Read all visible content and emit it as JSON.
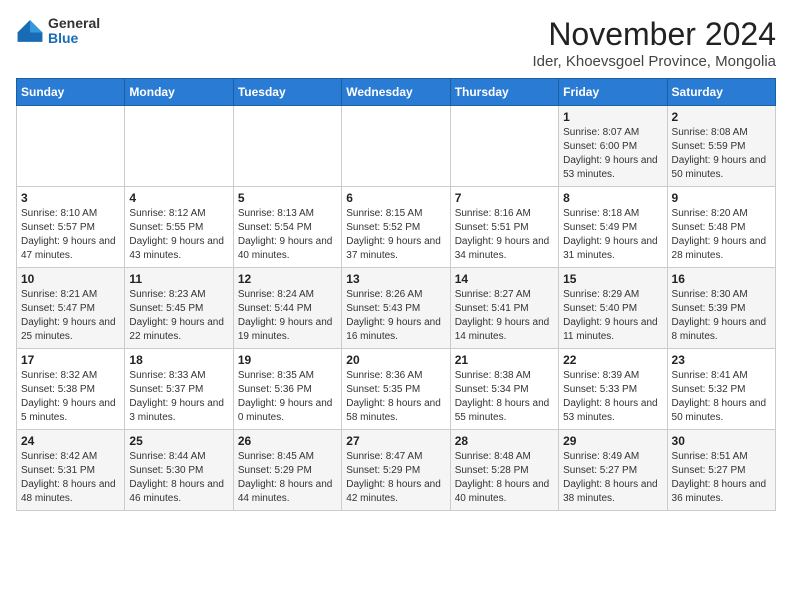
{
  "logo": {
    "general": "General",
    "blue": "Blue"
  },
  "title": "November 2024",
  "subtitle": "Ider, Khoevsgoel Province, Mongolia",
  "days_of_week": [
    "Sunday",
    "Monday",
    "Tuesday",
    "Wednesday",
    "Thursday",
    "Friday",
    "Saturday"
  ],
  "weeks": [
    [
      {
        "day": "",
        "details": ""
      },
      {
        "day": "",
        "details": ""
      },
      {
        "day": "",
        "details": ""
      },
      {
        "day": "",
        "details": ""
      },
      {
        "day": "",
        "details": ""
      },
      {
        "day": "1",
        "details": "Sunrise: 8:07 AM\nSunset: 6:00 PM\nDaylight: 9 hours and 53 minutes."
      },
      {
        "day": "2",
        "details": "Sunrise: 8:08 AM\nSunset: 5:59 PM\nDaylight: 9 hours and 50 minutes."
      }
    ],
    [
      {
        "day": "3",
        "details": "Sunrise: 8:10 AM\nSunset: 5:57 PM\nDaylight: 9 hours and 47 minutes."
      },
      {
        "day": "4",
        "details": "Sunrise: 8:12 AM\nSunset: 5:55 PM\nDaylight: 9 hours and 43 minutes."
      },
      {
        "day": "5",
        "details": "Sunrise: 8:13 AM\nSunset: 5:54 PM\nDaylight: 9 hours and 40 minutes."
      },
      {
        "day": "6",
        "details": "Sunrise: 8:15 AM\nSunset: 5:52 PM\nDaylight: 9 hours and 37 minutes."
      },
      {
        "day": "7",
        "details": "Sunrise: 8:16 AM\nSunset: 5:51 PM\nDaylight: 9 hours and 34 minutes."
      },
      {
        "day": "8",
        "details": "Sunrise: 8:18 AM\nSunset: 5:49 PM\nDaylight: 9 hours and 31 minutes."
      },
      {
        "day": "9",
        "details": "Sunrise: 8:20 AM\nSunset: 5:48 PM\nDaylight: 9 hours and 28 minutes."
      }
    ],
    [
      {
        "day": "10",
        "details": "Sunrise: 8:21 AM\nSunset: 5:47 PM\nDaylight: 9 hours and 25 minutes."
      },
      {
        "day": "11",
        "details": "Sunrise: 8:23 AM\nSunset: 5:45 PM\nDaylight: 9 hours and 22 minutes."
      },
      {
        "day": "12",
        "details": "Sunrise: 8:24 AM\nSunset: 5:44 PM\nDaylight: 9 hours and 19 minutes."
      },
      {
        "day": "13",
        "details": "Sunrise: 8:26 AM\nSunset: 5:43 PM\nDaylight: 9 hours and 16 minutes."
      },
      {
        "day": "14",
        "details": "Sunrise: 8:27 AM\nSunset: 5:41 PM\nDaylight: 9 hours and 14 minutes."
      },
      {
        "day": "15",
        "details": "Sunrise: 8:29 AM\nSunset: 5:40 PM\nDaylight: 9 hours and 11 minutes."
      },
      {
        "day": "16",
        "details": "Sunrise: 8:30 AM\nSunset: 5:39 PM\nDaylight: 9 hours and 8 minutes."
      }
    ],
    [
      {
        "day": "17",
        "details": "Sunrise: 8:32 AM\nSunset: 5:38 PM\nDaylight: 9 hours and 5 minutes."
      },
      {
        "day": "18",
        "details": "Sunrise: 8:33 AM\nSunset: 5:37 PM\nDaylight: 9 hours and 3 minutes."
      },
      {
        "day": "19",
        "details": "Sunrise: 8:35 AM\nSunset: 5:36 PM\nDaylight: 9 hours and 0 minutes."
      },
      {
        "day": "20",
        "details": "Sunrise: 8:36 AM\nSunset: 5:35 PM\nDaylight: 8 hours and 58 minutes."
      },
      {
        "day": "21",
        "details": "Sunrise: 8:38 AM\nSunset: 5:34 PM\nDaylight: 8 hours and 55 minutes."
      },
      {
        "day": "22",
        "details": "Sunrise: 8:39 AM\nSunset: 5:33 PM\nDaylight: 8 hours and 53 minutes."
      },
      {
        "day": "23",
        "details": "Sunrise: 8:41 AM\nSunset: 5:32 PM\nDaylight: 8 hours and 50 minutes."
      }
    ],
    [
      {
        "day": "24",
        "details": "Sunrise: 8:42 AM\nSunset: 5:31 PM\nDaylight: 8 hours and 48 minutes."
      },
      {
        "day": "25",
        "details": "Sunrise: 8:44 AM\nSunset: 5:30 PM\nDaylight: 8 hours and 46 minutes."
      },
      {
        "day": "26",
        "details": "Sunrise: 8:45 AM\nSunset: 5:29 PM\nDaylight: 8 hours and 44 minutes."
      },
      {
        "day": "27",
        "details": "Sunrise: 8:47 AM\nSunset: 5:29 PM\nDaylight: 8 hours and 42 minutes."
      },
      {
        "day": "28",
        "details": "Sunrise: 8:48 AM\nSunset: 5:28 PM\nDaylight: 8 hours and 40 minutes."
      },
      {
        "day": "29",
        "details": "Sunrise: 8:49 AM\nSunset: 5:27 PM\nDaylight: 8 hours and 38 minutes."
      },
      {
        "day": "30",
        "details": "Sunrise: 8:51 AM\nSunset: 5:27 PM\nDaylight: 8 hours and 36 minutes."
      }
    ]
  ]
}
